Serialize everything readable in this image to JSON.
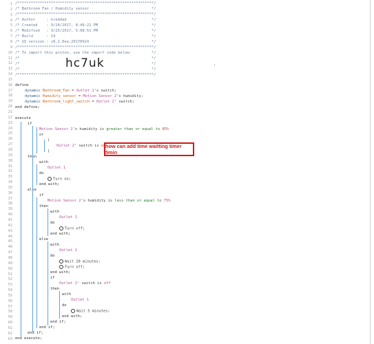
{
  "header": [
    "/*************************************************************/",
    "/* Bathroom Fan / Humidity sensor                            */",
    "/*************************************************************/",
    "/* Author     : kreddad                                      */",
    "/* Created    : 9/24/2017, 8:49:22 PM                        */",
    "/* Modified   : 9/25/2017, 5:08:51 PM                        */",
    "/* Build      : 14                                           */",
    "/* UI version : v0.2.0ea.20170924                            */",
    "/*************************************************************/",
    "/* To import this piston, use the import code below:         */",
    "/*                                                           */",
    "/*                                                           */",
    "/*                                                           */",
    "/*************************************************************/"
  ],
  "import_code": "hc7uk",
  "line_numbers": [
    "1",
    "2",
    "3",
    "4",
    "5",
    "6",
    "7",
    "8",
    "9",
    "10",
    "11",
    "12",
    "13",
    "14",
    "15",
    "16",
    "17",
    "18",
    "19",
    "20",
    "21",
    "22",
    "23",
    "24",
    "25",
    "26",
    "27",
    "28",
    "29",
    "30",
    "31",
    "32",
    "33",
    "34",
    "35",
    "36",
    "37",
    "38",
    "39",
    "40",
    "41",
    "42",
    "43",
    "44",
    "45",
    "46",
    "47",
    "48",
    "49",
    "50",
    "51",
    "52",
    "53",
    "54",
    "55",
    "56",
    "57",
    "58",
    "59",
    "60",
    "61",
    "62",
    "63"
  ],
  "code": {
    "define": "define",
    "dyn1": "dynamic",
    "var1": "Bathroom_Fan",
    "eq1": " = ",
    "dev1": "Outlet 1",
    "suf1": "'s switch;",
    "dyn2": "dynamic",
    "var2": "Humidity_sensor",
    "eq2": " = ",
    "dev2": "Motion Sensor 2",
    "suf2": "'s humidity;",
    "dyn3": "dynamic",
    "var3": "Bathroom_light_switch",
    "eq3": " = ",
    "dev3": "Outlet 2",
    "suf3": "' switch;",
    "end_define": "end define;",
    "execute": "execute",
    "if": "if",
    "cond1_dev": "Motion Sensor 2",
    "cond1_mid": "'s humidity is ",
    "cond1_op": "greater than or equal to",
    "cond1_val": "85%",
    "or": "or",
    "paren_open": "(",
    "cond2_dev": "Outlet 2",
    "cond2_text": "' switch is ",
    "cond2_val": "on",
    "paren_close": ")",
    "then": "then",
    "with": "with",
    "outlet1": "Outlet 1",
    "do": "do",
    "turn_on": "Turn on;",
    "end_with": "end with;",
    "else": "else",
    "cond3_dev": "Motion Sensor 2",
    "cond3_mid": "'s humidity is ",
    "cond3_op": "less than or equal to",
    "cond3_val": "75%",
    "turn_off": "Turn off;",
    "wait20": "Wait 20 minutes;",
    "cond4_dev": "Outlet 2",
    "cond4_text": "' switch is ",
    "cond4_val": "off",
    "wait5": "Wait 5 minutes;",
    "end_if": "end if;",
    "end_execute": "end execute;"
  },
  "callout": "how can add time waitting timer 5min"
}
